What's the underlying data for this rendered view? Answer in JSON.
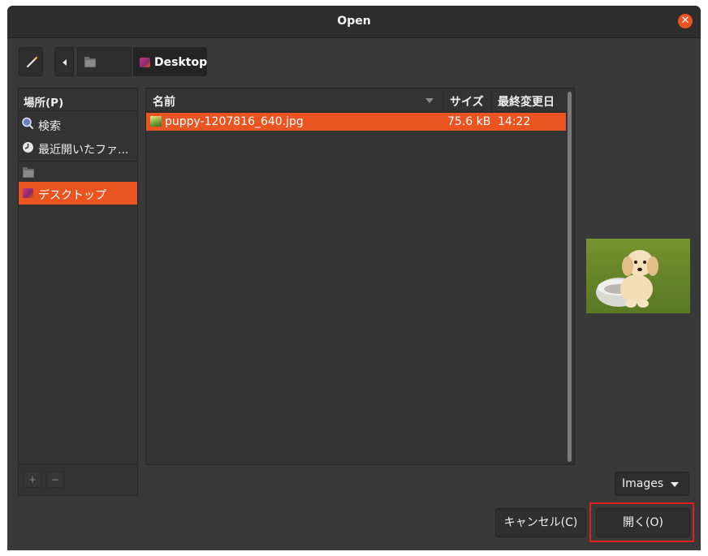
{
  "window": {
    "title": "Open",
    "close_icon": "✕"
  },
  "path_bar": {
    "current_folder": "Desktop"
  },
  "sidebar": {
    "header": "場所(P)",
    "items": [
      {
        "label": "検索",
        "icon": "search-icon"
      },
      {
        "label": "最近開いたファ...",
        "icon": "recent-icon"
      },
      {
        "label": "",
        "icon": "folder-icon"
      },
      {
        "label": "デスクトップ",
        "icon": "desktop-icon",
        "selected": true
      }
    ],
    "add_label": "+",
    "remove_label": "−"
  },
  "file_list": {
    "columns": {
      "name": "名前",
      "size": "サイズ",
      "modified": "最終変更日"
    },
    "rows": [
      {
        "name": "puppy-1207816_640.jpg",
        "size": "75.6 kB",
        "modified": "14:22",
        "selected": true
      }
    ]
  },
  "filter": {
    "selected": "Images"
  },
  "buttons": {
    "cancel": "キャンセル(C)",
    "open": "開く(O)"
  },
  "colors": {
    "accent": "#e95420",
    "highlight": "#e0201c"
  }
}
